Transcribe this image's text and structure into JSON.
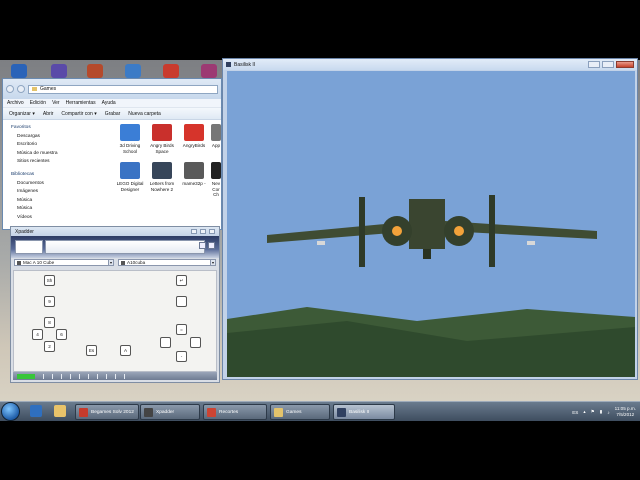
{
  "explorer": {
    "address": "Games",
    "menu": [
      "Archivo",
      "Edición",
      "Ver",
      "Herramientas",
      "Ayuda"
    ],
    "commands": [
      "Organizar ▾",
      "Abrir",
      "Compartir con ▾",
      "Grabar",
      "Nueva carpeta"
    ],
    "nav": {
      "favorites_label": "Favoritos",
      "favorites": [
        "Descargas",
        "Escritorio",
        "Música de muestra",
        "Sitios recientes"
      ],
      "libraries_label": "Bibliotecas",
      "libraries": [
        "Documentos",
        "Imágenes",
        "Música",
        "Música",
        "Vídeos"
      ]
    },
    "files": [
      {
        "label": "3d Driving School",
        "color": "#3b7ed6"
      },
      {
        "label": "Angry Birds Space",
        "color": "#c9302c"
      },
      {
        "label": "AngryBirds",
        "color": "#d6342b"
      },
      {
        "label": "App",
        "color": "#777"
      },
      {
        "label": "LEGO Digital Designer",
        "color": "#3a73c4"
      },
      {
        "label": "Letters from Nowhere 2",
        "color": "#37465a"
      },
      {
        "label": "mame32p -",
        "color": "#5a5a5a"
      },
      {
        "label": "Nev Cor Ch",
        "color": "#222"
      }
    ]
  },
  "xpadder": {
    "title": "Xpadder",
    "profile_left": "Mac A 10 Cube",
    "profile_right": "A10cuba",
    "keys": [
      "Sh",
      "9",
      "8",
      "4",
      "6",
      "2",
      "Es",
      "A",
      "↵",
      "",
      "=",
      "-"
    ]
  },
  "basilisk": {
    "title": "Basilisk II"
  },
  "taskbar": {
    "items": [
      "Begames Solv 2012",
      "Xpadder",
      "Recortes",
      "Games",
      "Basilisk II"
    ],
    "language": "ES",
    "time": "11:05 p.m.",
    "date": "7/5/2012"
  },
  "colors": {
    "sky": "#7aa2d6",
    "ground": "#3d5a37",
    "aircraft": "#3f4c33"
  }
}
